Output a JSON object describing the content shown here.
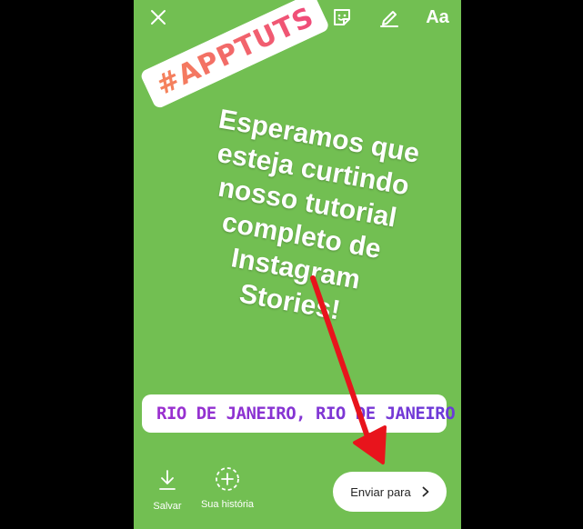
{
  "toolbar": {
    "text_button_label": "Aa"
  },
  "stickers": {
    "hashtag": "#APPTUTS",
    "location": "RIO DE JANEIRO, RIO DE JANEIRO"
  },
  "caption": {
    "lines": [
      "Esperamos que",
      "esteja curtindo",
      "nosso tutorial",
      "completo de",
      "Instagram",
      "Stories!"
    ]
  },
  "bottom_bar": {
    "save_label": "Salvar",
    "your_story_label": "Sua história",
    "send_label": "Enviar para"
  },
  "colors": {
    "background": "#72bf52",
    "arrow": "#e8141c",
    "location_text": "#8a33d4",
    "hashtag_gradient_start": "#f5845a",
    "hashtag_gradient_end": "#ef4b7a"
  }
}
